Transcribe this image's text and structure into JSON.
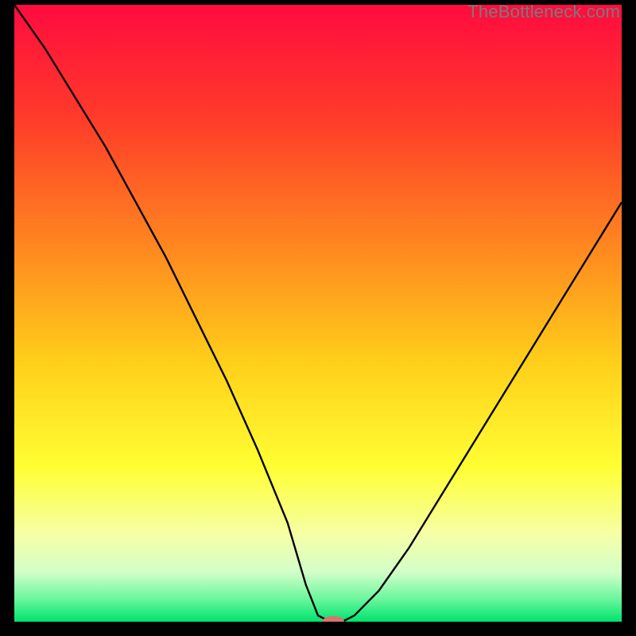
{
  "watermark": "TheBottleneck.com",
  "chart_data": {
    "type": "line",
    "title": "",
    "xlabel": "",
    "ylabel": "",
    "xlim": [
      0,
      100
    ],
    "ylim": [
      0,
      100
    ],
    "x": [
      0,
      5,
      10,
      15,
      20,
      25,
      30,
      35,
      40,
      45,
      48,
      50,
      52,
      54,
      56,
      60,
      65,
      70,
      75,
      80,
      85,
      90,
      95,
      100
    ],
    "values": [
      100,
      93,
      85,
      77,
      68,
      59,
      49,
      39,
      28,
      16,
      6,
      1,
      0,
      0,
      1,
      5,
      12,
      20,
      28,
      36,
      44,
      52,
      60,
      68
    ],
    "gradient_stops": [
      {
        "pos": 0.0,
        "color": "#ff0b3f"
      },
      {
        "pos": 0.18,
        "color": "#ff3a2a"
      },
      {
        "pos": 0.4,
        "color": "#ff8a1f"
      },
      {
        "pos": 0.58,
        "color": "#ffcf1a"
      },
      {
        "pos": 0.75,
        "color": "#ffff33"
      },
      {
        "pos": 0.86,
        "color": "#f6ffa8"
      },
      {
        "pos": 0.92,
        "color": "#d2ffc8"
      },
      {
        "pos": 0.965,
        "color": "#66f59a"
      },
      {
        "pos": 1.0,
        "color": "#00e36e"
      }
    ],
    "marker": {
      "x": 52.5,
      "y": 0,
      "color": "#d9746f",
      "rx": 14,
      "ry": 7
    }
  }
}
